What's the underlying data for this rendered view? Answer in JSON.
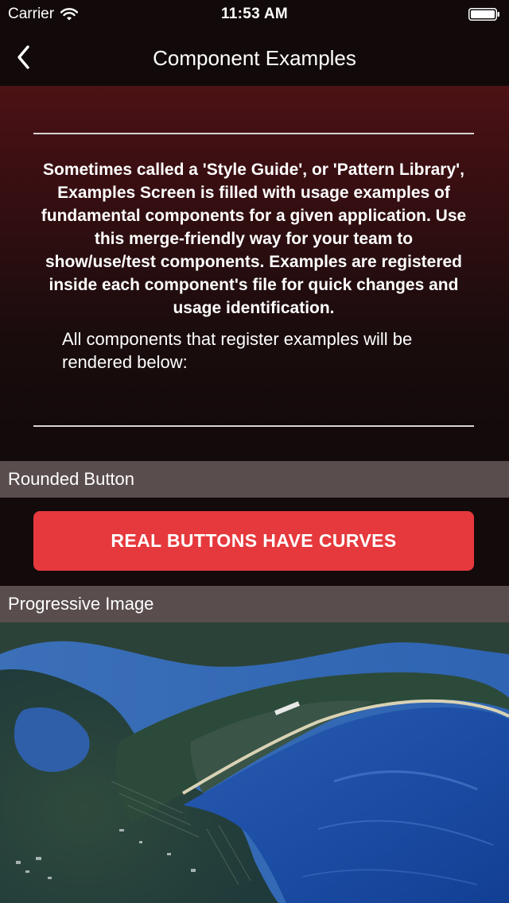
{
  "status_bar": {
    "carrier": "Carrier",
    "time": "11:53 AM"
  },
  "nav": {
    "title": "Component Examples",
    "back_icon": "chevron-left-icon"
  },
  "intro": {
    "bold_text": "Sometimes called a 'Style Guide', or 'Pattern Library', Examples Screen is filled with usage examples of fundamental components for a given application.  Use this merge-friendly way for your team to show/use/test components.  Examples are registered inside each component's file for quick changes and usage identification.",
    "normal_text": "All components that register examples will be rendered below:"
  },
  "sections": {
    "rounded_button": {
      "header": "Rounded Button",
      "button_label": "REAL BUTTONS HAVE CURVES"
    },
    "progressive_image": {
      "header": "Progressive Image"
    }
  },
  "colors": {
    "accent_button": "#e6393d",
    "section_header_bg": "#5a4d4d",
    "nav_bg": "#120a0a",
    "gradient_top": "#5e1518"
  }
}
